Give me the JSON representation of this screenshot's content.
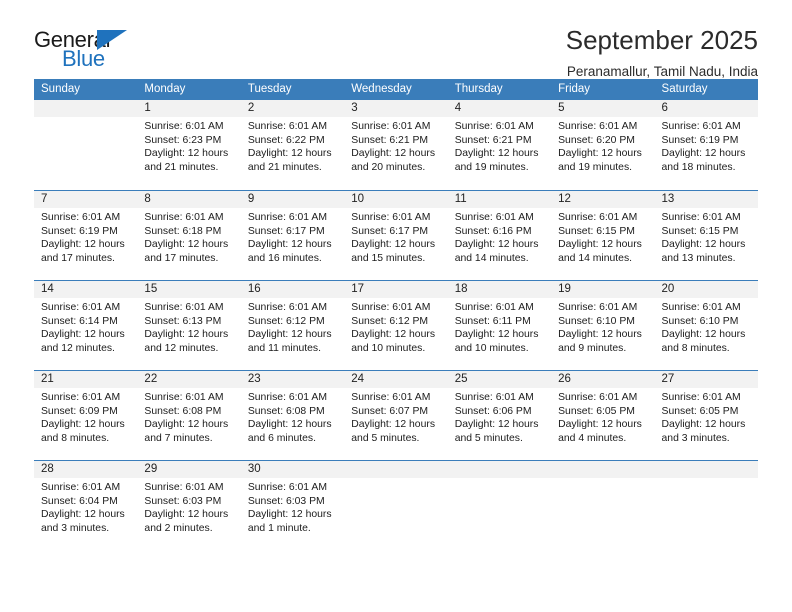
{
  "brand": {
    "name_part1": "General",
    "name_part2": "Blue",
    "triangle_icon": "triangle-icon",
    "accent_color": "#1f72bd"
  },
  "header": {
    "title": "September 2025",
    "subtitle": "Peranamallur, Tamil Nadu, India"
  },
  "calendar": {
    "header_color": "#3a7dba",
    "daynum_band_color": "#f2f2f2",
    "weekdays": [
      "Sunday",
      "Monday",
      "Tuesday",
      "Wednesday",
      "Thursday",
      "Friday",
      "Saturday"
    ],
    "weeks": [
      [
        {
          "day": "",
          "lines": []
        },
        {
          "day": "1",
          "lines": [
            "Sunrise: 6:01 AM",
            "Sunset: 6:23 PM",
            "Daylight: 12 hours",
            "and 21 minutes."
          ]
        },
        {
          "day": "2",
          "lines": [
            "Sunrise: 6:01 AM",
            "Sunset: 6:22 PM",
            "Daylight: 12 hours",
            "and 21 minutes."
          ]
        },
        {
          "day": "3",
          "lines": [
            "Sunrise: 6:01 AM",
            "Sunset: 6:21 PM",
            "Daylight: 12 hours",
            "and 20 minutes."
          ]
        },
        {
          "day": "4",
          "lines": [
            "Sunrise: 6:01 AM",
            "Sunset: 6:21 PM",
            "Daylight: 12 hours",
            "and 19 minutes."
          ]
        },
        {
          "day": "5",
          "lines": [
            "Sunrise: 6:01 AM",
            "Sunset: 6:20 PM",
            "Daylight: 12 hours",
            "and 19 minutes."
          ]
        },
        {
          "day": "6",
          "lines": [
            "Sunrise: 6:01 AM",
            "Sunset: 6:19 PM",
            "Daylight: 12 hours",
            "and 18 minutes."
          ]
        }
      ],
      [
        {
          "day": "7",
          "lines": [
            "Sunrise: 6:01 AM",
            "Sunset: 6:19 PM",
            "Daylight: 12 hours",
            "and 17 minutes."
          ]
        },
        {
          "day": "8",
          "lines": [
            "Sunrise: 6:01 AM",
            "Sunset: 6:18 PM",
            "Daylight: 12 hours",
            "and 17 minutes."
          ]
        },
        {
          "day": "9",
          "lines": [
            "Sunrise: 6:01 AM",
            "Sunset: 6:17 PM",
            "Daylight: 12 hours",
            "and 16 minutes."
          ]
        },
        {
          "day": "10",
          "lines": [
            "Sunrise: 6:01 AM",
            "Sunset: 6:17 PM",
            "Daylight: 12 hours",
            "and 15 minutes."
          ]
        },
        {
          "day": "11",
          "lines": [
            "Sunrise: 6:01 AM",
            "Sunset: 6:16 PM",
            "Daylight: 12 hours",
            "and 14 minutes."
          ]
        },
        {
          "day": "12",
          "lines": [
            "Sunrise: 6:01 AM",
            "Sunset: 6:15 PM",
            "Daylight: 12 hours",
            "and 14 minutes."
          ]
        },
        {
          "day": "13",
          "lines": [
            "Sunrise: 6:01 AM",
            "Sunset: 6:15 PM",
            "Daylight: 12 hours",
            "and 13 minutes."
          ]
        }
      ],
      [
        {
          "day": "14",
          "lines": [
            "Sunrise: 6:01 AM",
            "Sunset: 6:14 PM",
            "Daylight: 12 hours",
            "and 12 minutes."
          ]
        },
        {
          "day": "15",
          "lines": [
            "Sunrise: 6:01 AM",
            "Sunset: 6:13 PM",
            "Daylight: 12 hours",
            "and 12 minutes."
          ]
        },
        {
          "day": "16",
          "lines": [
            "Sunrise: 6:01 AM",
            "Sunset: 6:12 PM",
            "Daylight: 12 hours",
            "and 11 minutes."
          ]
        },
        {
          "day": "17",
          "lines": [
            "Sunrise: 6:01 AM",
            "Sunset: 6:12 PM",
            "Daylight: 12 hours",
            "and 10 minutes."
          ]
        },
        {
          "day": "18",
          "lines": [
            "Sunrise: 6:01 AM",
            "Sunset: 6:11 PM",
            "Daylight: 12 hours",
            "and 10 minutes."
          ]
        },
        {
          "day": "19",
          "lines": [
            "Sunrise: 6:01 AM",
            "Sunset: 6:10 PM",
            "Daylight: 12 hours",
            "and 9 minutes."
          ]
        },
        {
          "day": "20",
          "lines": [
            "Sunrise: 6:01 AM",
            "Sunset: 6:10 PM",
            "Daylight: 12 hours",
            "and 8 minutes."
          ]
        }
      ],
      [
        {
          "day": "21",
          "lines": [
            "Sunrise: 6:01 AM",
            "Sunset: 6:09 PM",
            "Daylight: 12 hours",
            "and 8 minutes."
          ]
        },
        {
          "day": "22",
          "lines": [
            "Sunrise: 6:01 AM",
            "Sunset: 6:08 PM",
            "Daylight: 12 hours",
            "and 7 minutes."
          ]
        },
        {
          "day": "23",
          "lines": [
            "Sunrise: 6:01 AM",
            "Sunset: 6:08 PM",
            "Daylight: 12 hours",
            "and 6 minutes."
          ]
        },
        {
          "day": "24",
          "lines": [
            "Sunrise: 6:01 AM",
            "Sunset: 6:07 PM",
            "Daylight: 12 hours",
            "and 5 minutes."
          ]
        },
        {
          "day": "25",
          "lines": [
            "Sunrise: 6:01 AM",
            "Sunset: 6:06 PM",
            "Daylight: 12 hours",
            "and 5 minutes."
          ]
        },
        {
          "day": "26",
          "lines": [
            "Sunrise: 6:01 AM",
            "Sunset: 6:05 PM",
            "Daylight: 12 hours",
            "and 4 minutes."
          ]
        },
        {
          "day": "27",
          "lines": [
            "Sunrise: 6:01 AM",
            "Sunset: 6:05 PM",
            "Daylight: 12 hours",
            "and 3 minutes."
          ]
        }
      ],
      [
        {
          "day": "28",
          "lines": [
            "Sunrise: 6:01 AM",
            "Sunset: 6:04 PM",
            "Daylight: 12 hours",
            "and 3 minutes."
          ]
        },
        {
          "day": "29",
          "lines": [
            "Sunrise: 6:01 AM",
            "Sunset: 6:03 PM",
            "Daylight: 12 hours",
            "and 2 minutes."
          ]
        },
        {
          "day": "30",
          "lines": [
            "Sunrise: 6:01 AM",
            "Sunset: 6:03 PM",
            "Daylight: 12 hours",
            "and 1 minute."
          ]
        },
        {
          "day": "",
          "lines": []
        },
        {
          "day": "",
          "lines": []
        },
        {
          "day": "",
          "lines": []
        },
        {
          "day": "",
          "lines": []
        }
      ]
    ]
  }
}
